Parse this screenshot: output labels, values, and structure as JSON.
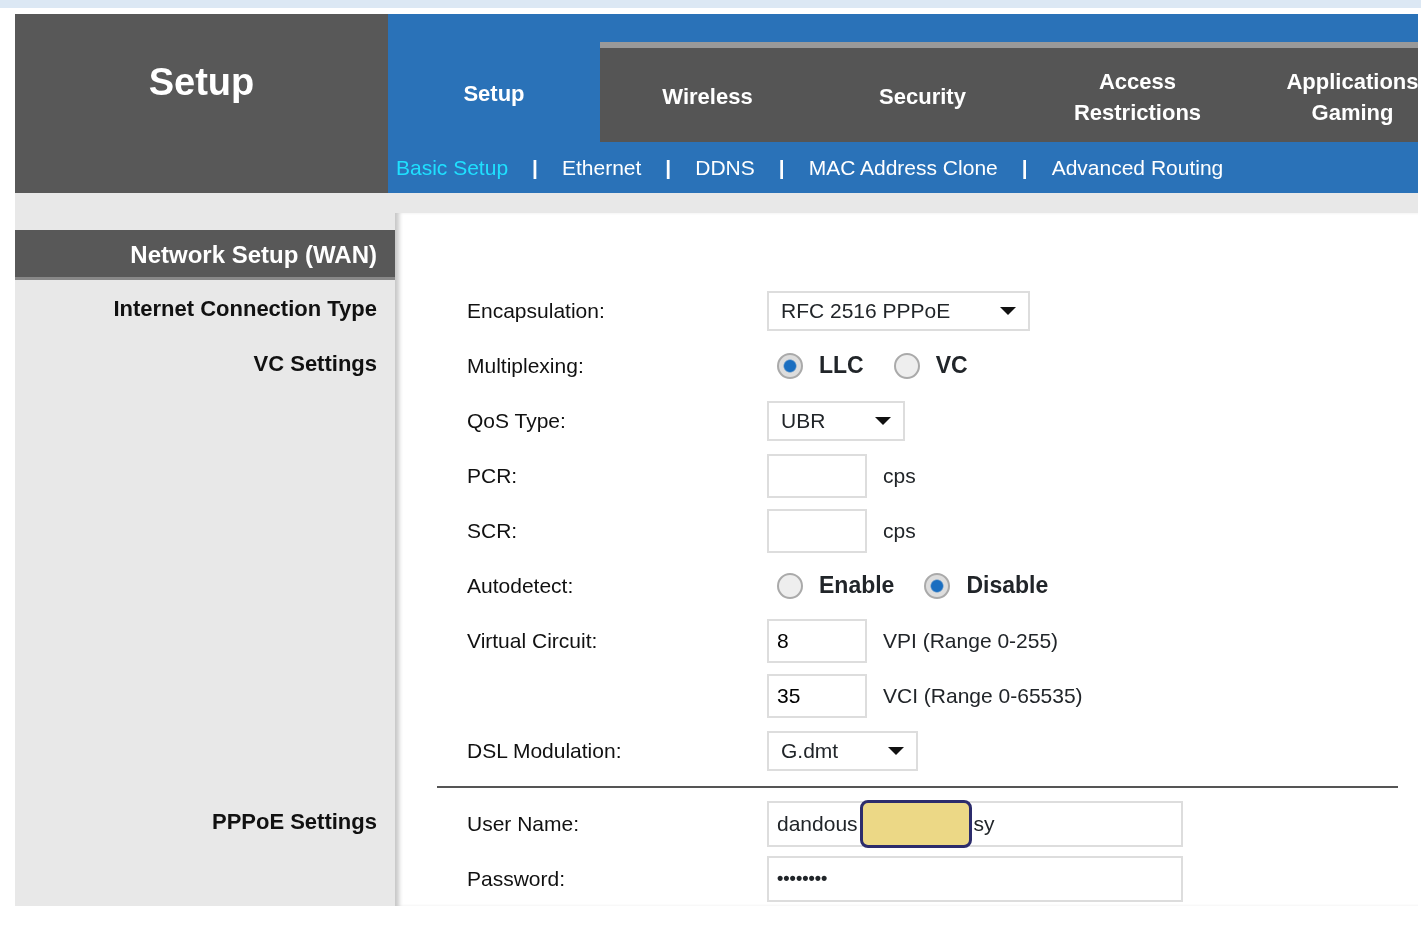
{
  "header": {
    "title": "Setup"
  },
  "tabs": [
    {
      "lines": [
        "Setup"
      ],
      "selected": true
    },
    {
      "lines": [
        "Wireless"
      ],
      "selected": false
    },
    {
      "lines": [
        "Security"
      ],
      "selected": false
    },
    {
      "lines": [
        "Access",
        "Restrictions"
      ],
      "selected": false
    },
    {
      "lines": [
        "Applications",
        "Gaming"
      ],
      "selected": false
    }
  ],
  "sub_nav": [
    {
      "kind": "link",
      "label": "Basic Setup",
      "selected": true
    },
    {
      "kind": "separator",
      "label": "|"
    },
    {
      "kind": "link",
      "label": "Ethernet",
      "selected": false
    },
    {
      "kind": "separator",
      "label": "|"
    },
    {
      "kind": "link",
      "label": "DDNS",
      "selected": false
    },
    {
      "kind": "separator",
      "label": "|"
    },
    {
      "kind": "link",
      "label": "MAC Address Clone",
      "selected": false
    },
    {
      "kind": "separator",
      "label": "|"
    },
    {
      "kind": "link",
      "label": "Advanced Routing",
      "selected": false
    }
  ],
  "sidebar": {
    "title": "Network Setup (WAN)"
  },
  "sections": [
    {
      "title": "Internet Connection Type",
      "rows": [
        {
          "kind": "select",
          "label": "Encapsulation:",
          "value": "RFC 2516 PPPoE"
        }
      ]
    },
    {
      "title": "VC Settings",
      "rows": [
        {
          "kind": "radio",
          "label": "Multiplexing:",
          "options": [
            {
              "label": "LLC",
              "selected": true
            },
            {
              "label": "VC",
              "selected": false
            }
          ]
        },
        {
          "kind": "select",
          "label": "QoS Type:",
          "value": "UBR"
        },
        {
          "kind": "input_unit",
          "label": "PCR:",
          "value": "",
          "unit": "cps"
        },
        {
          "kind": "input_unit",
          "label": "SCR:",
          "value": "",
          "unit": "cps"
        },
        {
          "kind": "radio",
          "label": "Autodetect:",
          "options": [
            {
              "label": "Enable",
              "selected": false
            },
            {
              "label": "Disable",
              "selected": true
            }
          ]
        },
        {
          "kind": "input_unit",
          "label": "Virtual Circuit:",
          "value": "8",
          "unit": "VPI (Range 0-255)"
        },
        {
          "kind": "input_unit",
          "value": "35",
          "unit": "VCI (Range 0-65535)"
        },
        {
          "kind": "select",
          "label": "DSL Modulation:",
          "value": "G.dmt"
        },
        {
          "kind": "divider"
        }
      ]
    },
    {
      "title": "PPPoE Settings",
      "rows": [
        {
          "kind": "redacted",
          "label": "User Name:",
          "value_start": "dandous",
          "value_end": "sy"
        },
        {
          "kind": "password",
          "label": "Password:",
          "value": "••••••••"
        }
      ]
    }
  ]
}
